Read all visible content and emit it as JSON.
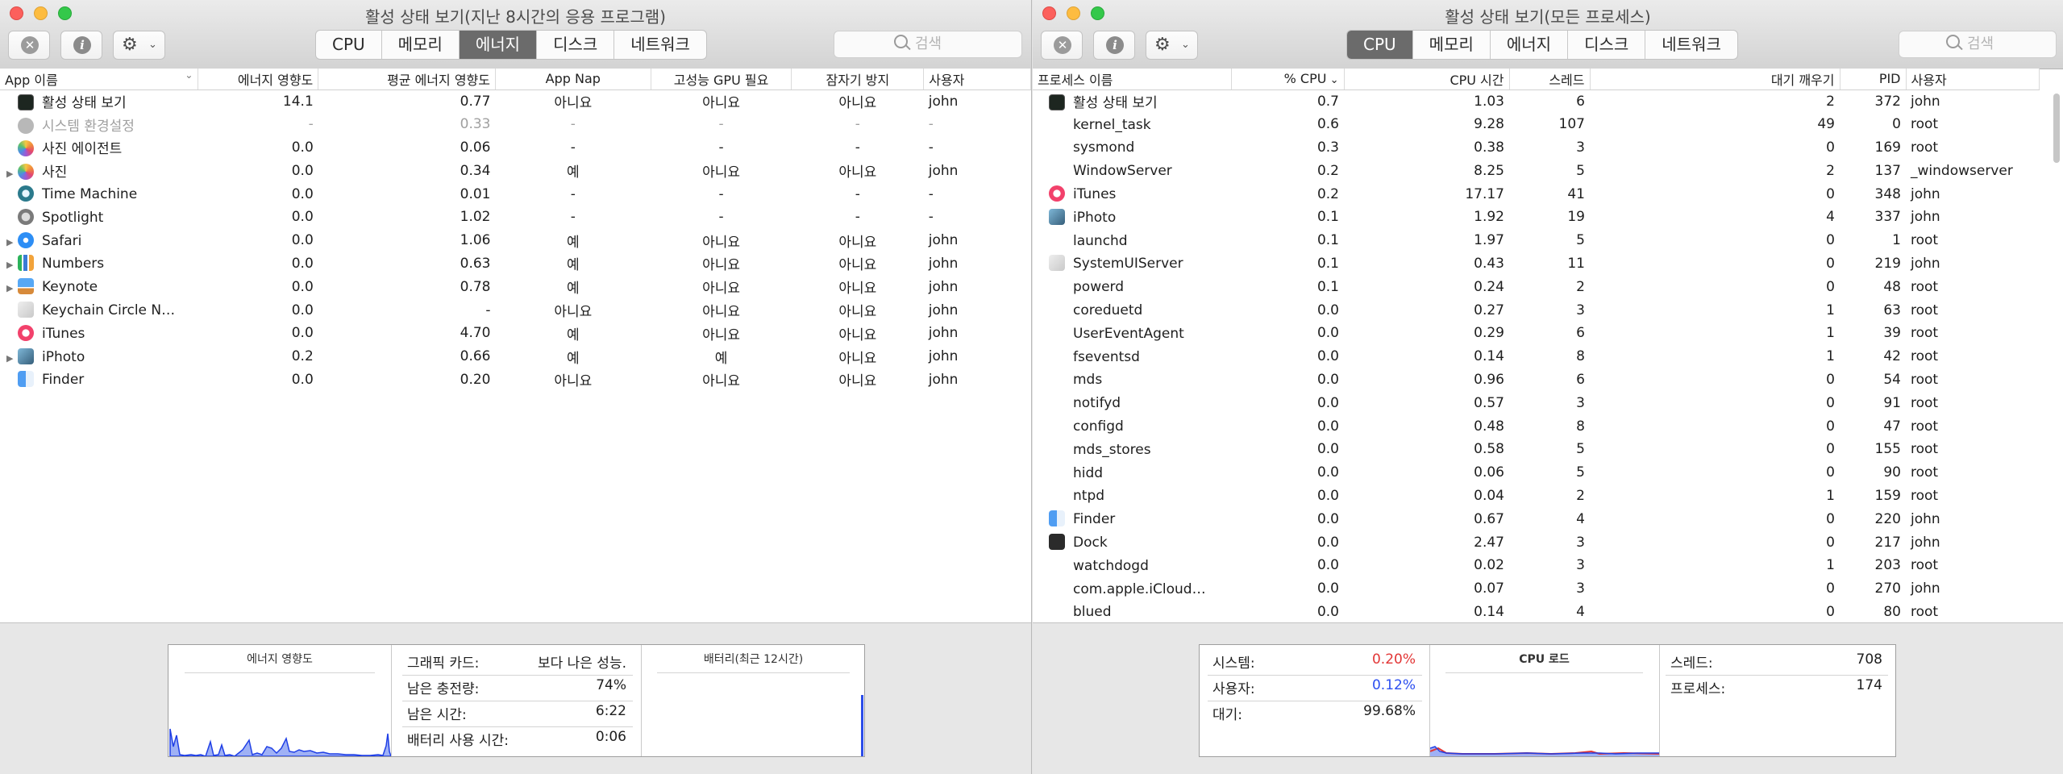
{
  "colors": {
    "system_red": "#e23636",
    "user_blue": "#2c4ff0",
    "graph_blue": "#1f3fe6"
  },
  "left": {
    "title": "활성 상태 보기(지난 8시간의 응용 프로그램)",
    "tabs": [
      "CPU",
      "메모리",
      "에너지",
      "디스크",
      "네트워크"
    ],
    "selected_tab": "에너지",
    "search_placeholder": "검색",
    "columns": [
      "App 이름",
      "에너지 영향도",
      "평균 에너지 영향도",
      "App Nap",
      "고성능 GPU 필요",
      "잠자기 방지",
      "사용자"
    ],
    "rows": [
      {
        "icon": "activity-monitor-icon",
        "expand": false,
        "dim": false,
        "name": "활성 상태 보기",
        "energy": "14.1",
        "avg": "0.77",
        "nap": "아니요",
        "gpu": "아니요",
        "sleep": "아니요",
        "user": "john"
      },
      {
        "icon": "system-preferences-icon",
        "expand": false,
        "dim": true,
        "name": "시스템 환경설정",
        "energy": "-",
        "avg": "0.33",
        "nap": "-",
        "gpu": "-",
        "sleep": "-",
        "user": "-"
      },
      {
        "icon": "photos-agent-icon",
        "expand": false,
        "dim": false,
        "name": "사진 에이전트",
        "energy": "0.0",
        "avg": "0.06",
        "nap": "-",
        "gpu": "-",
        "sleep": "-",
        "user": "-"
      },
      {
        "icon": "photos-icon",
        "expand": true,
        "dim": false,
        "name": "사진",
        "energy": "0.0",
        "avg": "0.34",
        "nap": "예",
        "gpu": "아니요",
        "sleep": "아니요",
        "user": "john"
      },
      {
        "icon": "time-machine-icon",
        "expand": false,
        "dim": false,
        "name": "Time Machine",
        "energy": "0.0",
        "avg": "0.01",
        "nap": "-",
        "gpu": "-",
        "sleep": "-",
        "user": "-"
      },
      {
        "icon": "spotlight-icon",
        "expand": false,
        "dim": false,
        "name": "Spotlight",
        "energy": "0.0",
        "avg": "1.02",
        "nap": "-",
        "gpu": "-",
        "sleep": "-",
        "user": "-"
      },
      {
        "icon": "safari-icon",
        "expand": true,
        "dim": false,
        "name": "Safari",
        "energy": "0.0",
        "avg": "1.06",
        "nap": "예",
        "gpu": "아니요",
        "sleep": "아니요",
        "user": "john"
      },
      {
        "icon": "numbers-icon",
        "expand": true,
        "dim": false,
        "name": "Numbers",
        "energy": "0.0",
        "avg": "0.63",
        "nap": "예",
        "gpu": "아니요",
        "sleep": "아니요",
        "user": "john"
      },
      {
        "icon": "keynote-icon",
        "expand": true,
        "dim": false,
        "name": "Keynote",
        "energy": "0.0",
        "avg": "0.78",
        "nap": "예",
        "gpu": "아니요",
        "sleep": "아니요",
        "user": "john"
      },
      {
        "icon": "keychain-icon",
        "expand": false,
        "dim": false,
        "name": "Keychain Circle N…",
        "energy": "0.0",
        "avg": "-",
        "nap": "아니요",
        "gpu": "아니요",
        "sleep": "아니요",
        "user": "john"
      },
      {
        "icon": "itunes-icon",
        "expand": false,
        "dim": false,
        "name": "iTunes",
        "energy": "0.0",
        "avg": "4.70",
        "nap": "예",
        "gpu": "아니요",
        "sleep": "아니요",
        "user": "john"
      },
      {
        "icon": "iphoto-icon",
        "expand": true,
        "dim": false,
        "name": "iPhoto",
        "energy": "0.2",
        "avg": "0.66",
        "nap": "예",
        "gpu": "예",
        "sleep": "아니요",
        "user": "john"
      },
      {
        "icon": "finder-icon",
        "expand": false,
        "dim": false,
        "name": "Finder",
        "energy": "0.0",
        "avg": "0.20",
        "nap": "아니요",
        "gpu": "아니요",
        "sleep": "아니요",
        "user": "john"
      }
    ],
    "footer": {
      "energy_title": "에너지 영향도",
      "stats": [
        {
          "label": "그래픽 카드:",
          "value": "보다 나은 성능."
        },
        {
          "label": "남은 충전량:",
          "value": "74%"
        },
        {
          "label": "남은 시간:",
          "value": "6:22"
        },
        {
          "label": "배터리 사용 시간:",
          "value": "0:06"
        }
      ],
      "battery_title": "배터리(최근 12시간)"
    }
  },
  "right": {
    "title": "활성 상태 보기(모든 프로세스)",
    "tabs": [
      "CPU",
      "메모리",
      "에너지",
      "디스크",
      "네트워크"
    ],
    "selected_tab": "CPU",
    "search_placeholder": "검색",
    "columns": [
      "프로세스 이름",
      "% CPU",
      "CPU 시간",
      "스레드",
      "대기 깨우기",
      "PID",
      "사용자"
    ],
    "sort_indicator": "⌄",
    "rows": [
      {
        "icon": "activity-monitor-icon",
        "name": "활성 상태 보기",
        "cpu": "0.7",
        "time": "1.03",
        "threads": "6",
        "wakes": "2",
        "pid": "372",
        "user": "john"
      },
      {
        "icon": "",
        "name": "kernel_task",
        "cpu": "0.6",
        "time": "9.28",
        "threads": "107",
        "wakes": "49",
        "pid": "0",
        "user": "root"
      },
      {
        "icon": "",
        "name": "sysmond",
        "cpu": "0.3",
        "time": "0.38",
        "threads": "3",
        "wakes": "0",
        "pid": "169",
        "user": "root"
      },
      {
        "icon": "",
        "name": "WindowServer",
        "cpu": "0.2",
        "time": "8.25",
        "threads": "5",
        "wakes": "2",
        "pid": "137",
        "user": "_windowserver"
      },
      {
        "icon": "itunes-icon",
        "name": "iTunes",
        "cpu": "0.2",
        "time": "17.17",
        "threads": "41",
        "wakes": "0",
        "pid": "348",
        "user": "john"
      },
      {
        "icon": "iphoto-icon",
        "name": "iPhoto",
        "cpu": "0.1",
        "time": "1.92",
        "threads": "19",
        "wakes": "4",
        "pid": "337",
        "user": "john"
      },
      {
        "icon": "",
        "name": "launchd",
        "cpu": "0.1",
        "time": "1.97",
        "threads": "5",
        "wakes": "0",
        "pid": "1",
        "user": "root"
      },
      {
        "icon": "system-ui-server-icon",
        "name": "SystemUIServer",
        "cpu": "0.1",
        "time": "0.43",
        "threads": "11",
        "wakes": "0",
        "pid": "219",
        "user": "john"
      },
      {
        "icon": "",
        "name": "powerd",
        "cpu": "0.1",
        "time": "0.24",
        "threads": "2",
        "wakes": "0",
        "pid": "48",
        "user": "root"
      },
      {
        "icon": "",
        "name": "coreduetd",
        "cpu": "0.0",
        "time": "0.27",
        "threads": "3",
        "wakes": "1",
        "pid": "63",
        "user": "root"
      },
      {
        "icon": "",
        "name": "UserEventAgent",
        "cpu": "0.0",
        "time": "0.29",
        "threads": "6",
        "wakes": "1",
        "pid": "39",
        "user": "root"
      },
      {
        "icon": "",
        "name": "fseventsd",
        "cpu": "0.0",
        "time": "0.14",
        "threads": "8",
        "wakes": "1",
        "pid": "42",
        "user": "root"
      },
      {
        "icon": "",
        "name": "mds",
        "cpu": "0.0",
        "time": "0.96",
        "threads": "6",
        "wakes": "0",
        "pid": "54",
        "user": "root"
      },
      {
        "icon": "",
        "name": "notifyd",
        "cpu": "0.0",
        "time": "0.57",
        "threads": "3",
        "wakes": "0",
        "pid": "91",
        "user": "root"
      },
      {
        "icon": "",
        "name": "configd",
        "cpu": "0.0",
        "time": "0.48",
        "threads": "8",
        "wakes": "0",
        "pid": "47",
        "user": "root"
      },
      {
        "icon": "",
        "name": "mds_stores",
        "cpu": "0.0",
        "time": "0.58",
        "threads": "5",
        "wakes": "0",
        "pid": "155",
        "user": "root"
      },
      {
        "icon": "",
        "name": "hidd",
        "cpu": "0.0",
        "time": "0.06",
        "threads": "5",
        "wakes": "0",
        "pid": "90",
        "user": "root"
      },
      {
        "icon": "",
        "name": "ntpd",
        "cpu": "0.0",
        "time": "0.04",
        "threads": "2",
        "wakes": "1",
        "pid": "159",
        "user": "root"
      },
      {
        "icon": "finder-icon",
        "name": "Finder",
        "cpu": "0.0",
        "time": "0.67",
        "threads": "4",
        "wakes": "0",
        "pid": "220",
        "user": "john"
      },
      {
        "icon": "dock-icon",
        "name": "Dock",
        "cpu": "0.0",
        "time": "2.47",
        "threads": "3",
        "wakes": "0",
        "pid": "217",
        "user": "john"
      },
      {
        "icon": "",
        "name": "watchdogd",
        "cpu": "0.0",
        "time": "0.02",
        "threads": "3",
        "wakes": "1",
        "pid": "203",
        "user": "root"
      },
      {
        "icon": "",
        "name": "com.apple.iCloud…",
        "cpu": "0.0",
        "time": "0.07",
        "threads": "3",
        "wakes": "0",
        "pid": "270",
        "user": "john"
      },
      {
        "icon": "",
        "name": "blued",
        "cpu": "0.0",
        "time": "0.14",
        "threads": "4",
        "wakes": "0",
        "pid": "80",
        "user": "root"
      }
    ],
    "footer": {
      "stats_left": [
        {
          "label": "시스템:",
          "value": "0.20%",
          "color": "#e23636"
        },
        {
          "label": "사용자:",
          "value": "0.12%",
          "color": "#2c4ff0"
        },
        {
          "label": "대기:",
          "value": "99.68%",
          "color": "#1e1e1e"
        }
      ],
      "cpu_load_title": "CPU 로드",
      "stats_right": [
        {
          "label": "스레드:",
          "value": "708"
        },
        {
          "label": "프로세스:",
          "value": "174"
        }
      ]
    }
  }
}
